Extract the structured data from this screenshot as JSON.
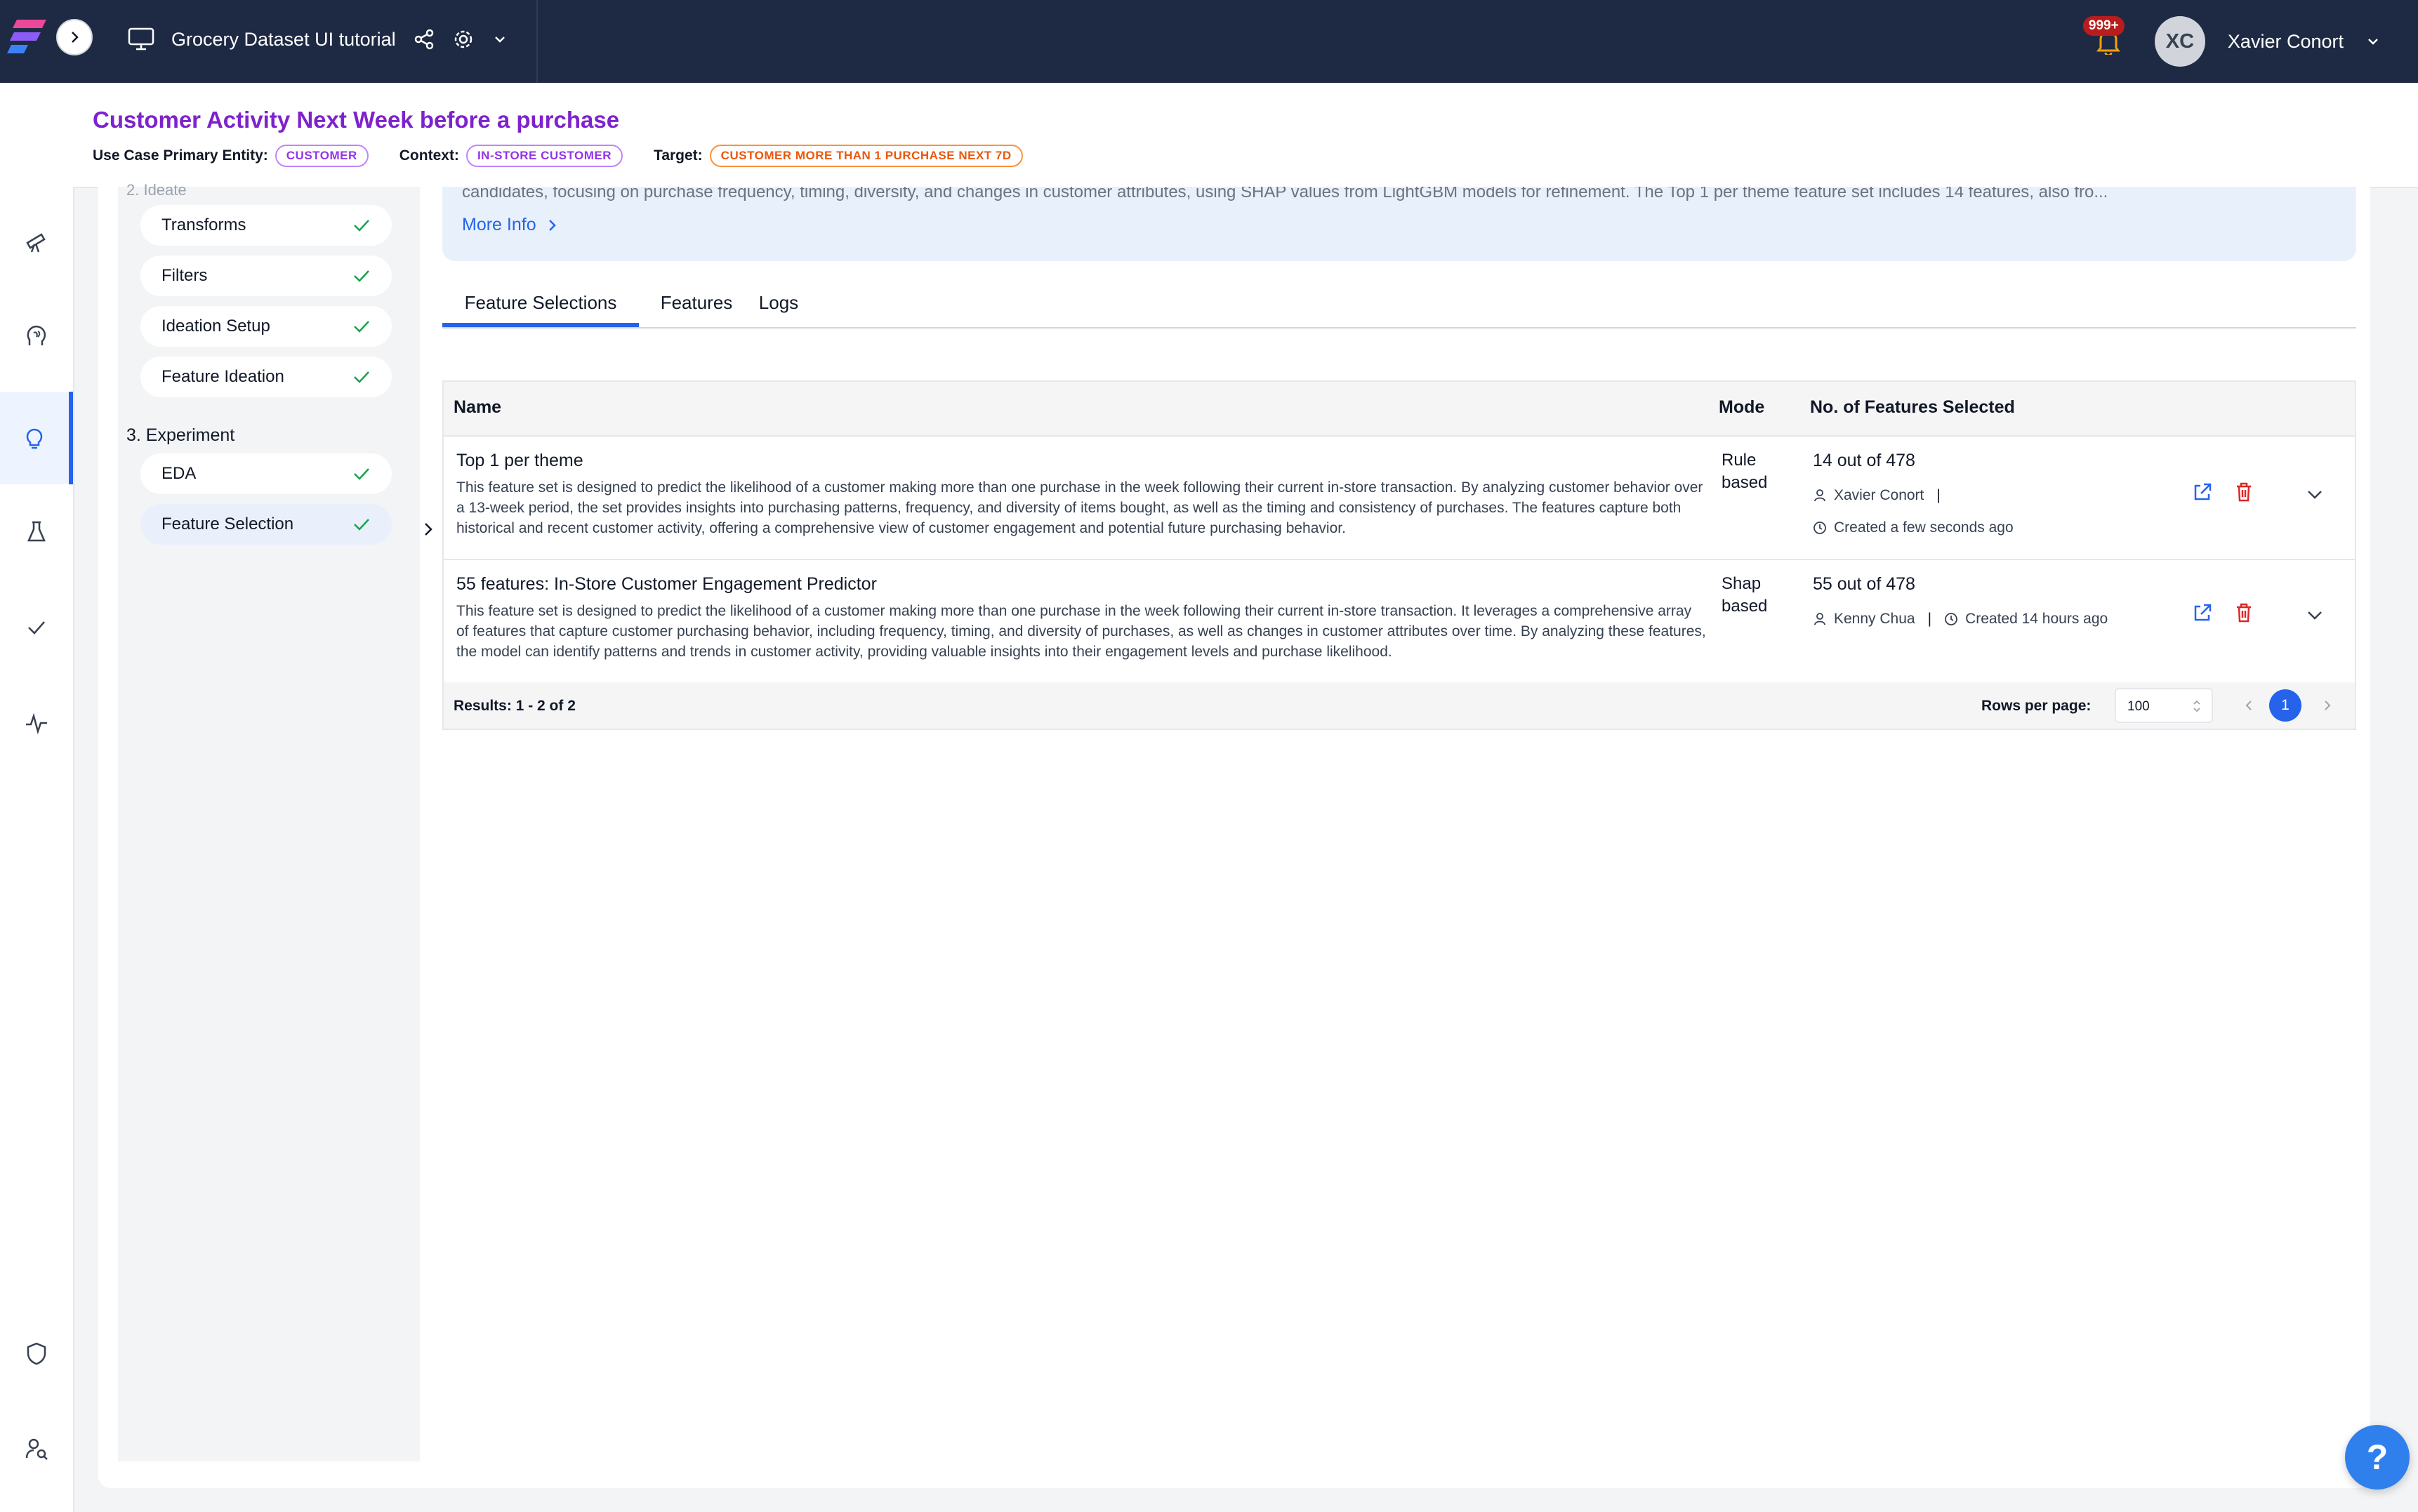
{
  "topbar": {
    "project_title": "Grocery Dataset UI tutorial",
    "notification_count": "999+",
    "user_initials": "XC",
    "user_name": "Xavier Conort"
  },
  "use_case": {
    "title": "Customer Activity Next Week before a purchase",
    "entity_label": "Use Case Primary Entity:",
    "entity_value": "CUSTOMER",
    "context_label": "Context:",
    "context_value": "IN-STORE CUSTOMER",
    "target_label": "Target:",
    "target_value": "CUSTOMER MORE THAN 1 PURCHASE NEXT 7D"
  },
  "steps": {
    "faded_label": "2. Ideate",
    "ideate_items": [
      {
        "label": "Transforms"
      },
      {
        "label": "Filters"
      },
      {
        "label": "Ideation Setup"
      },
      {
        "label": "Feature Ideation"
      }
    ],
    "experiment_label": "3. Experiment",
    "experiment_items": [
      {
        "label": "EDA"
      },
      {
        "label": "Feature Selection"
      }
    ]
  },
  "info": {
    "text": "candidates, focusing on purchase frequency, timing, diversity, and changes in customer attributes, using SHAP values from LightGBM models for refinement. The Top 1 per theme feature set includes 14 features, also fro...",
    "more_label": "More Info"
  },
  "tabs": [
    {
      "label": "Feature Selections"
    },
    {
      "label": "Features"
    },
    {
      "label": "Logs"
    }
  ],
  "table": {
    "headers": {
      "name": "Name",
      "mode": "Mode",
      "count": "No. of Features Selected"
    },
    "rows": [
      {
        "name": "Top 1 per theme",
        "description": "This feature set is designed to predict the likelihood of a customer making more than one purchase in the week following their current in-store transaction. By analyzing customer behavior over a 13-week period, the set provides insights into purchasing patterns, frequency, and diversity of items bought, as well as the timing and consistency of purchases. The features capture both historical and recent customer activity, offering a comprehensive view of customer engagement and potential future purchasing behavior.",
        "mode": "Rule based",
        "count": "14 out of 478",
        "author": "Xavier Conort",
        "created": "Created a few seconds ago"
      },
      {
        "name": "55 features: In-Store Customer Engagement Predictor",
        "description": "This feature set is designed to predict the likelihood of a customer making more than one purchase in the week following their current in-store transaction. It leverages a comprehensive array of features that capture customer purchasing behavior, including frequency, timing, and diversity of purchases, as well as changes in customer attributes over time. By analyzing these features, the model can identify patterns and trends in customer activity, providing valuable insights into their engagement levels and purchase likelihood.",
        "mode": "Shap based",
        "count": "55 out of 478",
        "author": "Kenny Chua",
        "created": "Created 14 hours ago"
      }
    ],
    "results": "Results: 1 - 2 of 2",
    "rows_per_page_label": "Rows per page:",
    "rows_per_page": "100",
    "current_page": "1"
  },
  "help": {
    "label": "?"
  },
  "colors": {
    "accent": "#2563eb",
    "title": "#7e22ce",
    "topbar": "#1e2a44",
    "check": "#16a34a",
    "delete": "#dc2626"
  }
}
